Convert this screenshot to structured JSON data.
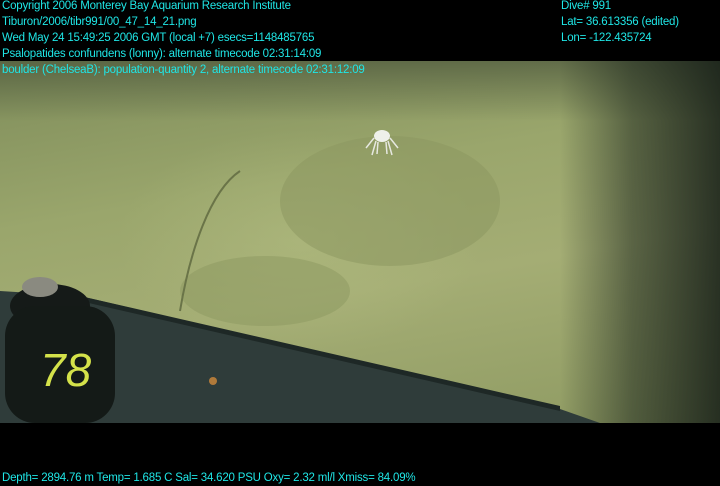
{
  "overlay": {
    "copyright": "Copyright 2006 Monterey Bay Aquarium Research Institute",
    "file_path": "Tiburon/2006/tibr991/00_47_14_21.png",
    "datetime": "Wed May 24 15:49:25 2006 GMT (local +7)  esecs=1148485765",
    "annotation_1": "Psalopatides confundens (lonny): alternate timecode 02:31:14:09",
    "annotation_2": "boulder (ChelseaB): population-quantity 2, alternate timecode 02:31:12:09",
    "dive": "Dive# 991",
    "lat": "Lat= 36.613356 (edited)",
    "lon": "Lon= -122.435724",
    "sensors": "Depth= 2894.76 m  Temp= 1.685 C  Sal= 34.620 PSU  Oxy= 2.32 ml/l  Xmiss= 84.09%"
  },
  "marker_label": "78",
  "colors": {
    "overlay_text": "#1fe6e6",
    "seafloor": "#9aa66c"
  }
}
